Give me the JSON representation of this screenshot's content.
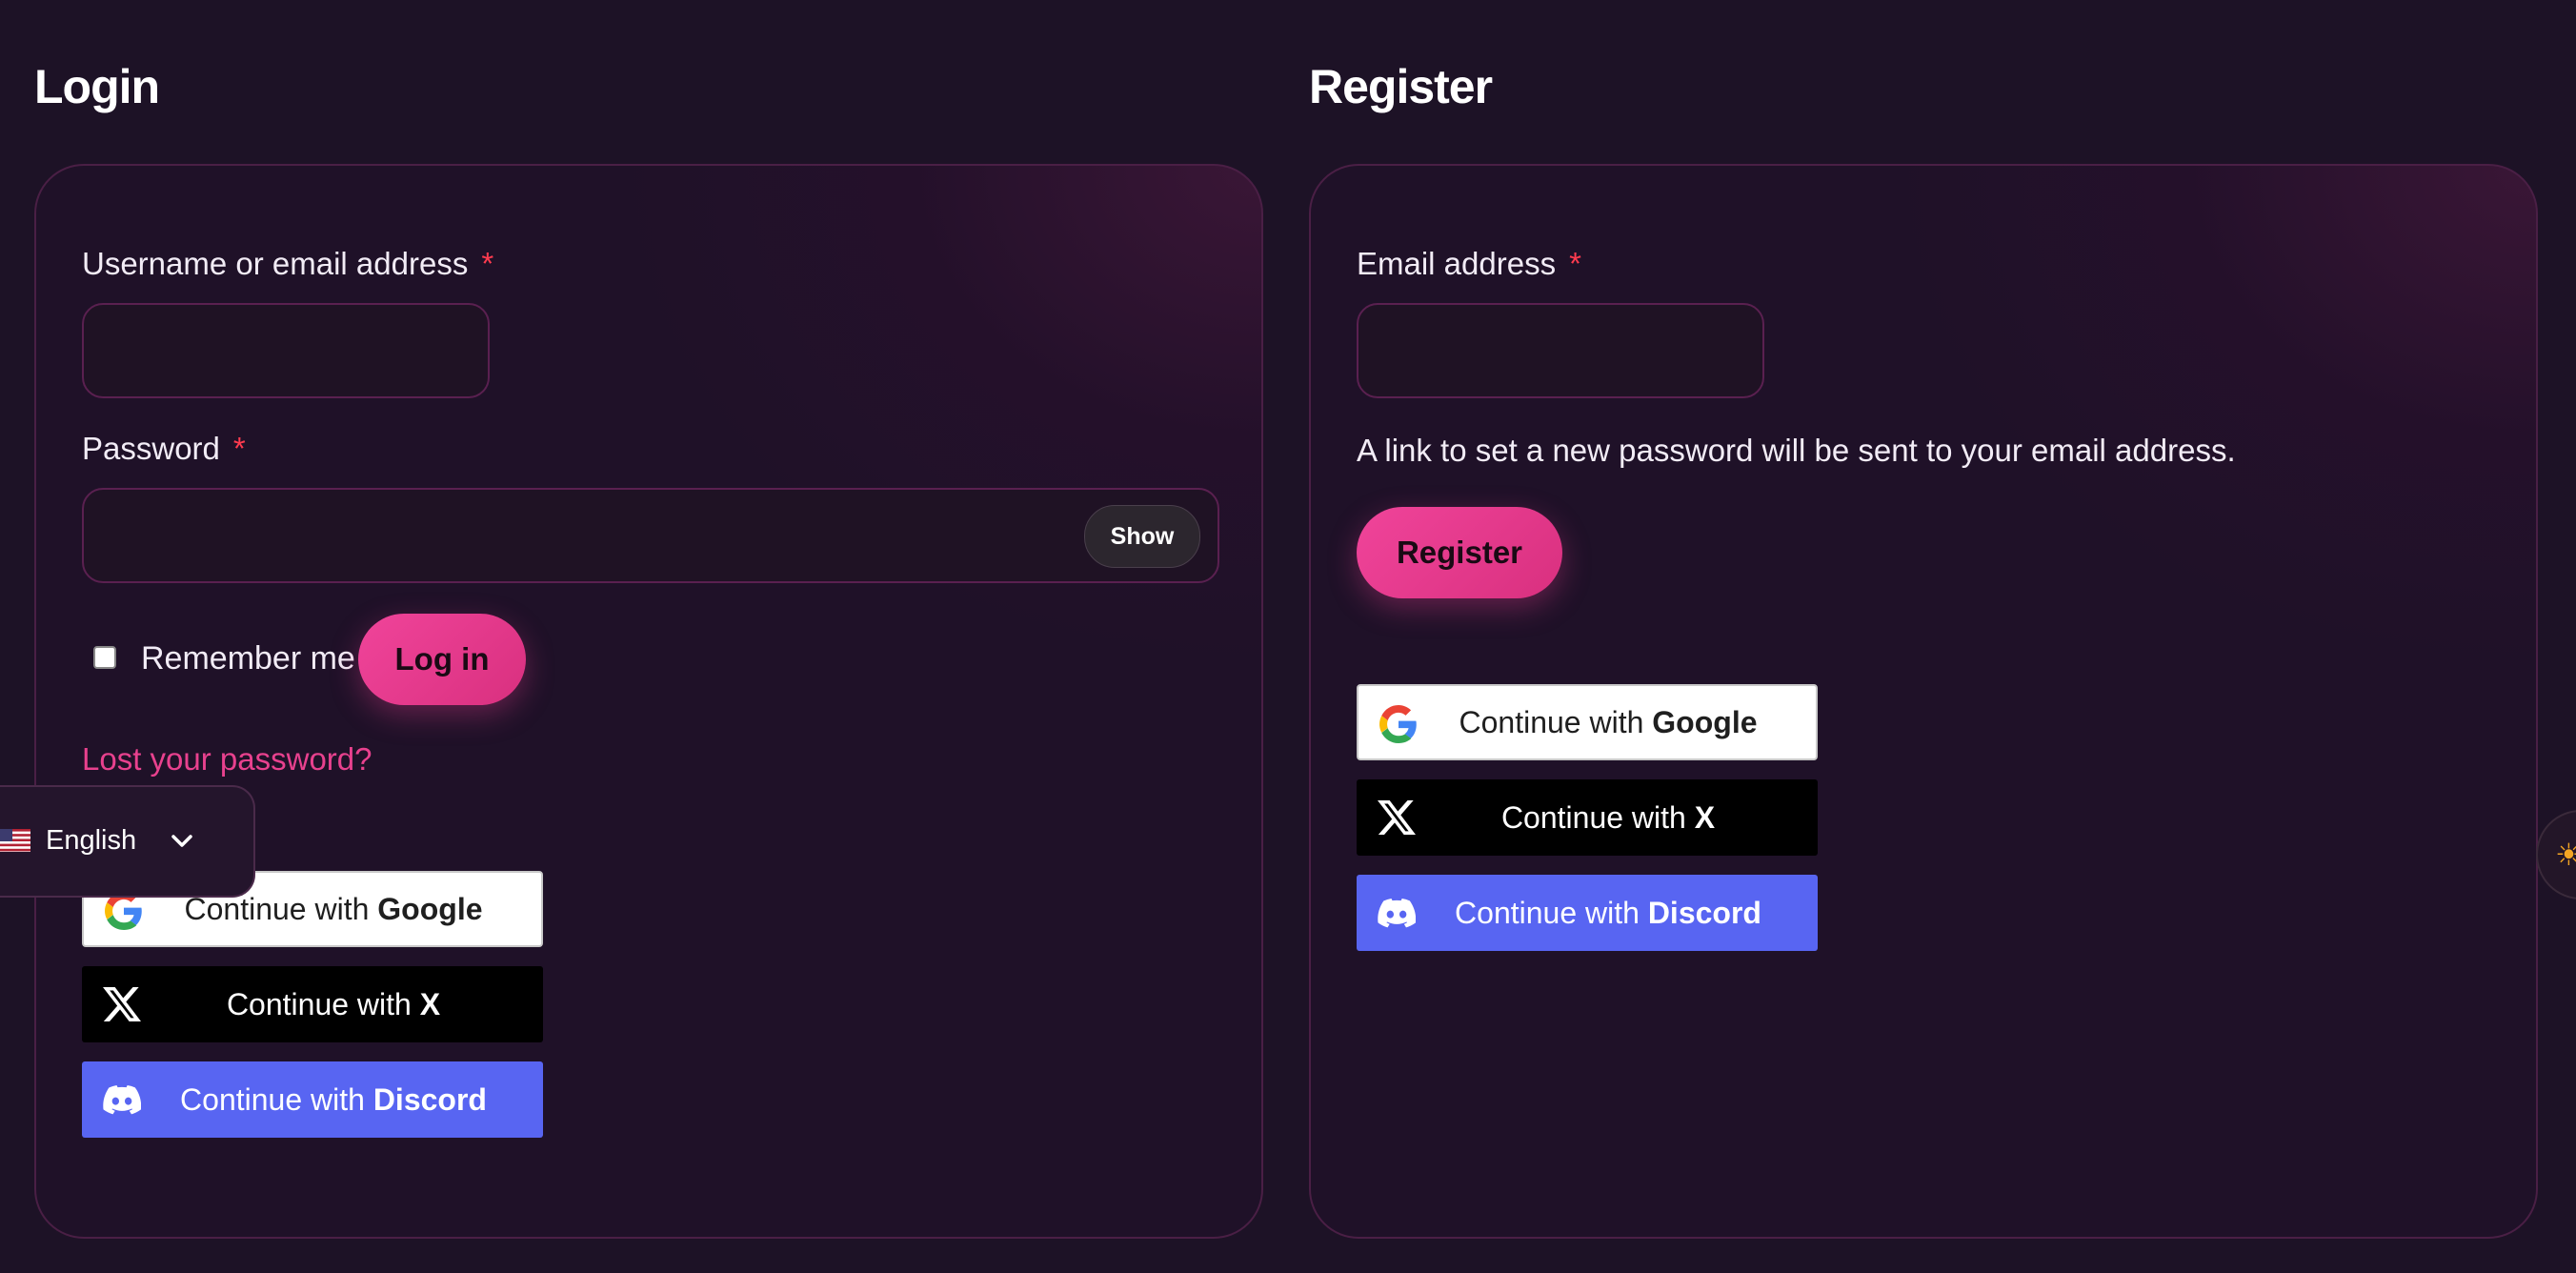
{
  "login": {
    "heading": "Login",
    "username_label": "Username or email address",
    "required_mark": "*",
    "username_value": "",
    "password_label": "Password",
    "password_value": "",
    "show_label": "Show",
    "remember_label": "Remember me",
    "remember_checked": false,
    "login_button": "Log in",
    "lost_password": "Lost your password?",
    "social": {
      "prefix": "Continue with",
      "google": "Google",
      "x": "X",
      "discord": "Discord"
    }
  },
  "register": {
    "heading": "Register",
    "email_label": "Email address",
    "required_mark": "*",
    "email_value": "",
    "info": "A link to set a new password will be sent to your email address.",
    "register_button": "Register",
    "social": {
      "prefix": "Continue with",
      "google": "Google",
      "x": "X",
      "discord": "Discord"
    }
  },
  "language": {
    "selected": "English",
    "flag_icon": "us-flag-icon"
  },
  "colors": {
    "accent": "#e8418e",
    "required": "#ff3b4f",
    "discord": "#5865f2",
    "background": "#1d1226"
  }
}
